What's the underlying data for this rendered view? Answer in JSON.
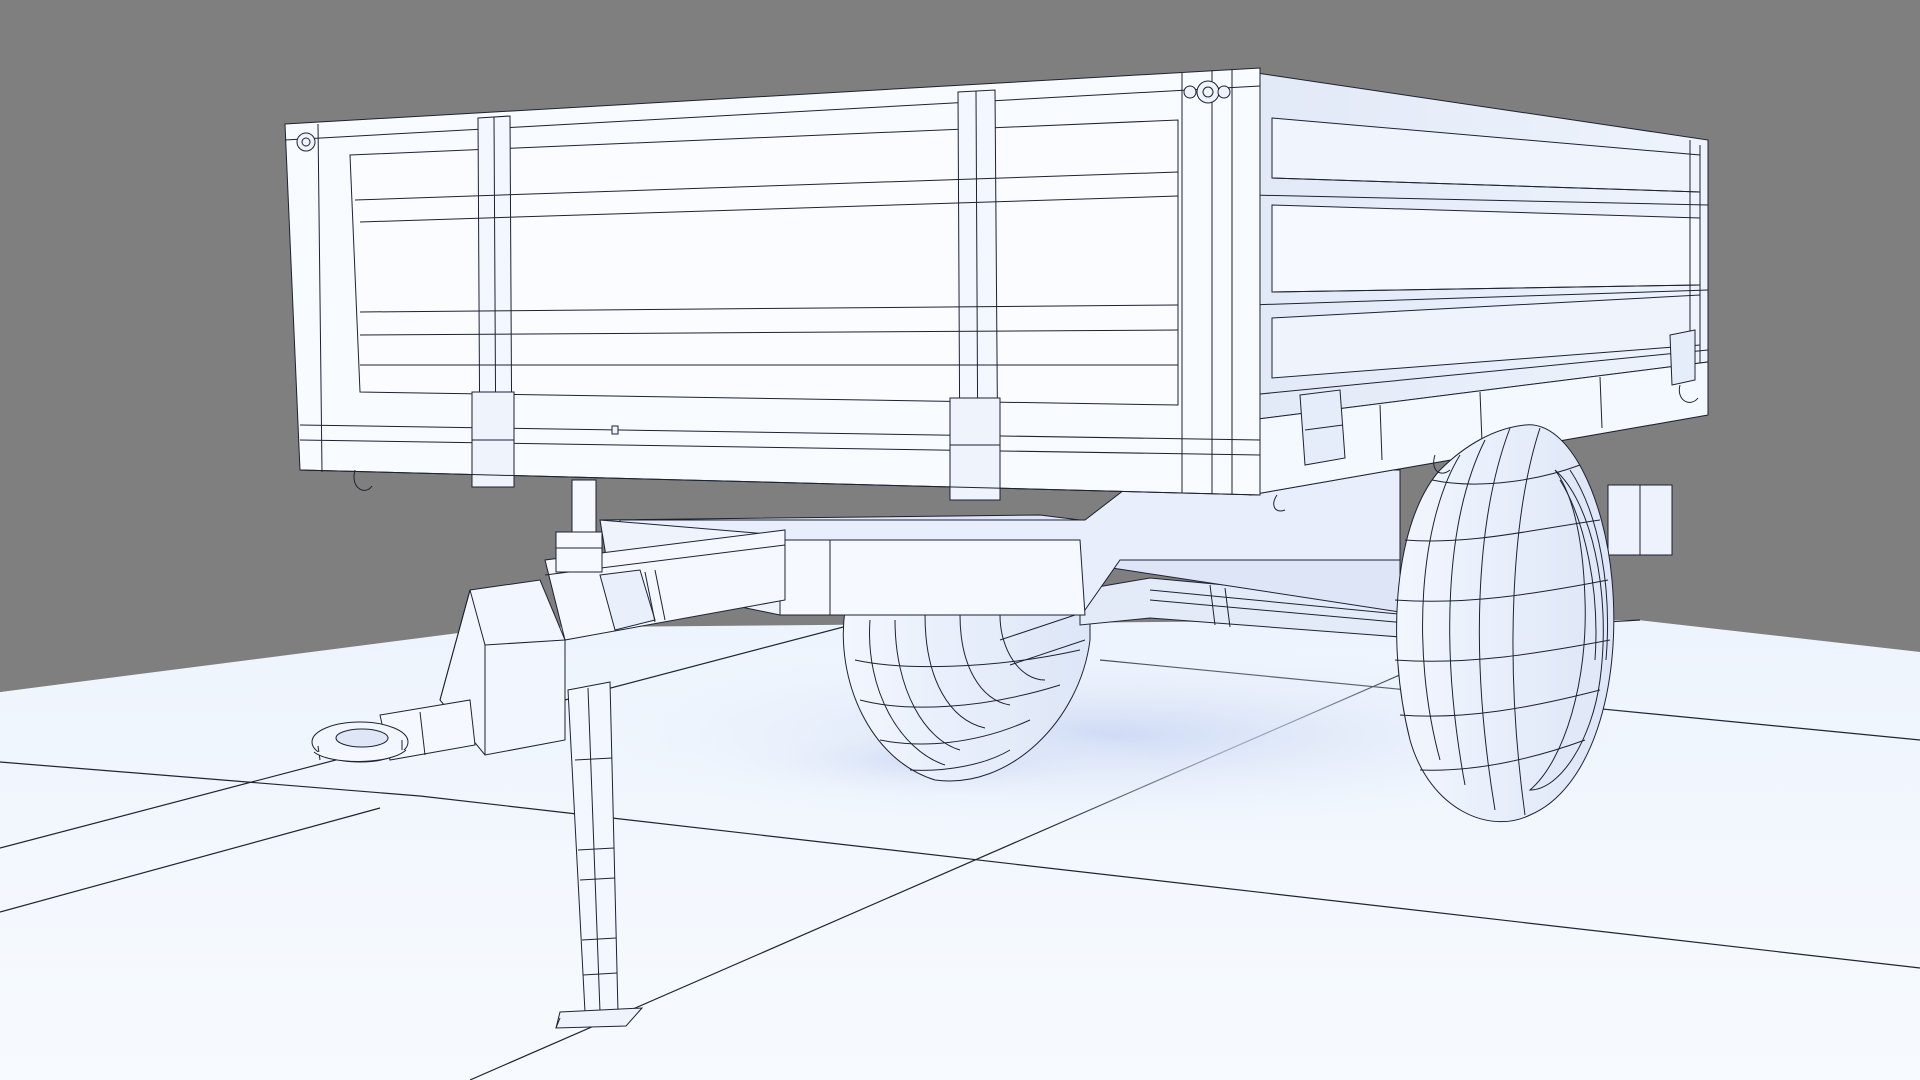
{
  "scene": {
    "subject": "wireframe-trailer-render",
    "colors": {
      "background": "#7f7f7f",
      "floor": "#f3f8fe",
      "floor_shadow": "#dfe9fb",
      "model_light": "#f7faff",
      "model_mid": "#e4ebf9",
      "model_shadow": "#cfd8ef",
      "wire": "#1d2233",
      "grid": "#1e2433"
    }
  }
}
